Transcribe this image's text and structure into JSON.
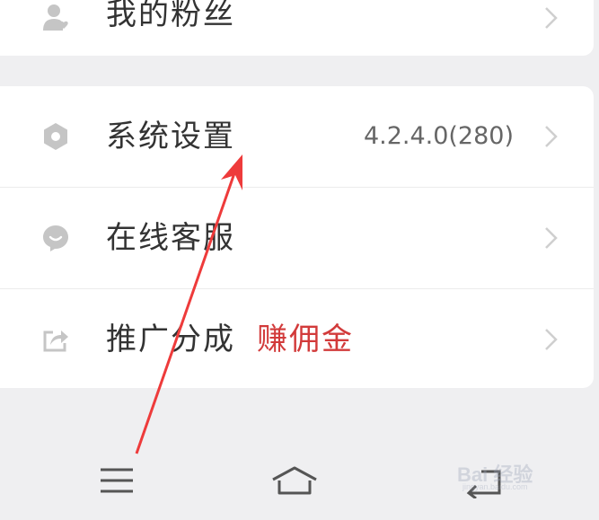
{
  "menu_top": {
    "fans_label": "我的粉丝"
  },
  "menu_main": {
    "items": [
      {
        "label": "系统设置",
        "value": "4.2.4.0(280)"
      },
      {
        "label": "在线客服",
        "value": ""
      },
      {
        "label": "推广分成",
        "value": "",
        "tag": "赚佣金"
      }
    ]
  },
  "watermark": {
    "brand": "Bai  经验",
    "sub": "jingyan.baidu.com"
  },
  "colors": {
    "icon_gray": "#c5c5c5",
    "chevron_gray": "#cfcfcf",
    "accent_red": "#d23a3a",
    "annotation_arrow": "#ee3b3b"
  }
}
